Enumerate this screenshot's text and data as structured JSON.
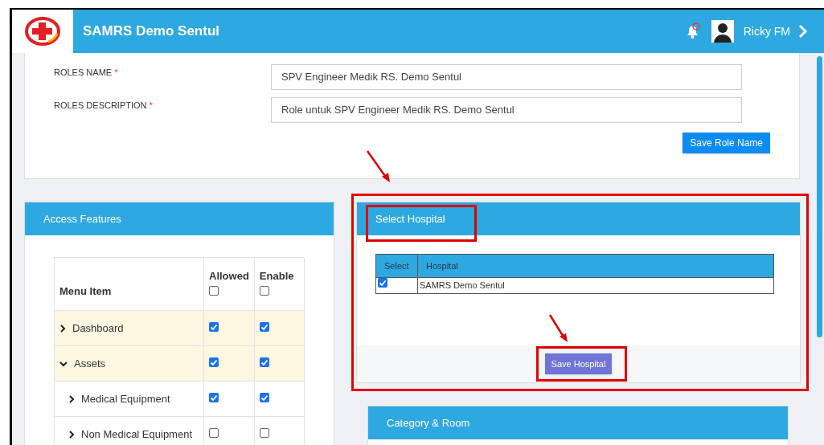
{
  "header": {
    "title": "SAMRS Demo Sentul",
    "user_name": "Ricky FM"
  },
  "role_form": {
    "fields": [
      {
        "label": "ROLES NAME",
        "required_mark": "*",
        "value": "SPV Engineer Medik RS. Demo Sentul"
      },
      {
        "label": "ROLES DESCRIPTION",
        "required_mark": "*",
        "value": "Role untuk SPV Engineer Medik RS. Demo Sentul"
      }
    ],
    "button": "Save Role Name"
  },
  "access_features": {
    "title": "Access Features",
    "columns": [
      "Menu Item",
      "Allowed",
      "Enable"
    ],
    "header_allowed_checked": false,
    "header_enable_checked": false,
    "rows": [
      {
        "label": "Dashboard",
        "expanded": false,
        "allowed": true,
        "enable": true,
        "highlighted": true,
        "children": []
      },
      {
        "label": "Assets",
        "expanded": true,
        "allowed": true,
        "enable": true,
        "highlighted": true,
        "children": [
          {
            "label": "Medical Equipment",
            "expanded": false,
            "allowed": true,
            "enable": true,
            "highlighted": false
          },
          {
            "label": "Non Medical Equipment",
            "expanded": false,
            "allowed": false,
            "enable": false,
            "highlighted": false
          }
        ]
      }
    ]
  },
  "select_hospital": {
    "title": "Select Hospital",
    "columns": [
      "Select",
      "Hospital"
    ],
    "rows": [
      {
        "checked": true,
        "hospital": "SAMRS Demo Sentul"
      }
    ],
    "button": "Save Hospital"
  },
  "category_room": {
    "title": "Category & Room"
  }
}
